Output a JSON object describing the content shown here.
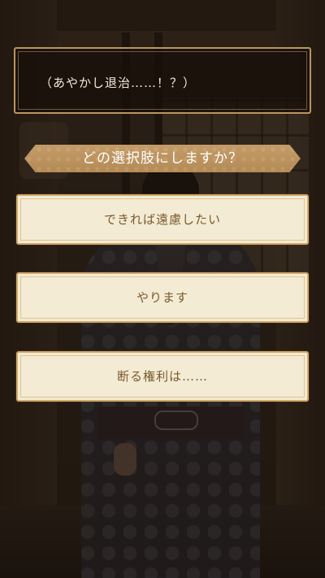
{
  "dialogue": {
    "text": "（あやかし退治……！？）"
  },
  "prompt": {
    "text": "どの選択肢にしますか？"
  },
  "choices": [
    {
      "label": "できれば遠慮したい"
    },
    {
      "label": "やります"
    },
    {
      "label": "断る権利は……"
    }
  ],
  "colors": {
    "accent_gold": "#b99660",
    "choice_bg": "#f3ebd3",
    "choice_text": "#7a5a2e",
    "banner": "#c49c68"
  }
}
